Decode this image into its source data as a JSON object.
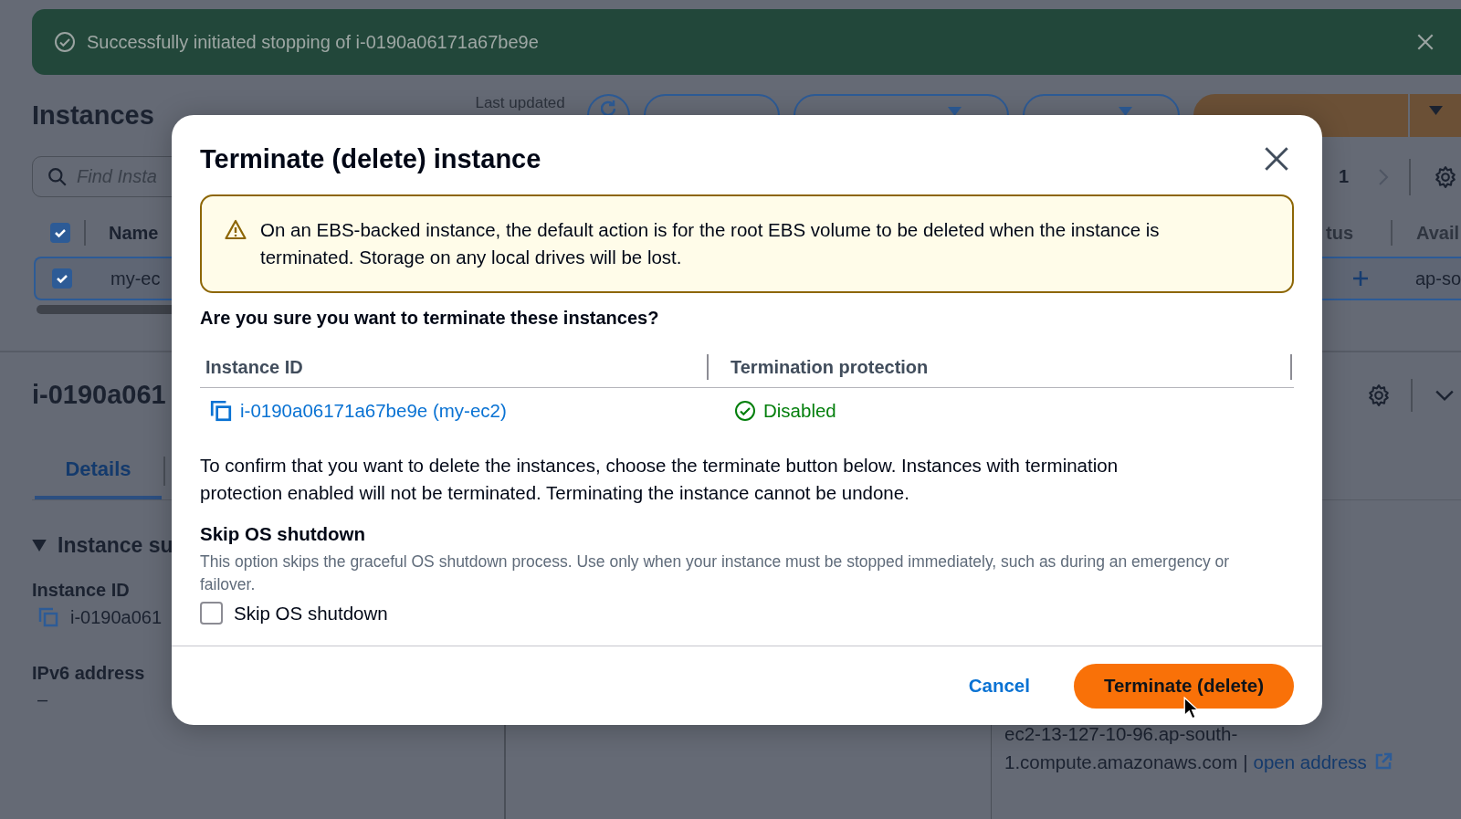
{
  "flash": {
    "message": "Successfully initiated stopping of i-0190a06171a67be9e"
  },
  "header": {
    "title": "Instances",
    "last_updated": "Last updated",
    "buttons": [
      {
        "kind": "outline"
      },
      {
        "kind": "dropdown"
      },
      {
        "kind": "dropdown"
      },
      {
        "kind": "primary"
      }
    ]
  },
  "search": {
    "placeholder": "Find Insta"
  },
  "pagination": {
    "page": "1"
  },
  "table": {
    "columns": [
      "Name",
      "tus",
      "Avail"
    ],
    "select_all_checked": true,
    "rows": [
      {
        "selected": true,
        "checked": true,
        "cells": [
          "my-ec",
          "",
          "ap-so"
        ]
      }
    ]
  },
  "details": {
    "title": "i-0190a061",
    "tabs": [
      {
        "label": "Details",
        "selected": true
      }
    ],
    "section": "Instance su",
    "fields": [
      {
        "label": "Instance ID",
        "value": "i-0190a061",
        "kind": "copyable"
      },
      {
        "label": "IPv6 address",
        "value": "–",
        "kind": "plain"
      }
    ],
    "public_dns": "ec2-13-127-10-96.ap-south-1.compute.amazonaws.com",
    "separator": "|",
    "open_link": "open address"
  },
  "modal": {
    "title": "Terminate (delete) instance",
    "warning": "On an EBS-backed instance, the default action is for the root EBS volume to be deleted when the instance is terminated. Storage on any local drives will be lost.",
    "question": "Are you sure you want to terminate these instances?",
    "columns": [
      "Instance ID",
      "Termination protection"
    ],
    "rows": [
      {
        "instance": "i-0190a06171a67be9e (my-ec2)",
        "protection": "Disabled",
        "protected": false
      }
    ],
    "confirm_text": "To confirm that you want to delete the instances, choose the terminate button below. Instances with termination protection enabled will not be terminated. Terminating the instance cannot be undone.",
    "skip_title": "Skip OS shutdown",
    "skip_description": "This option skips the graceful OS shutdown process. Use only when your instance must be stopped immediately, such as during an emergency or failover.",
    "skip_checkbox": {
      "label": "Skip OS shutdown",
      "checked": false
    },
    "buttons": [
      {
        "label": "Cancel",
        "kind": "link"
      },
      {
        "label": "Terminate (delete)",
        "kind": "primary"
      }
    ]
  }
}
